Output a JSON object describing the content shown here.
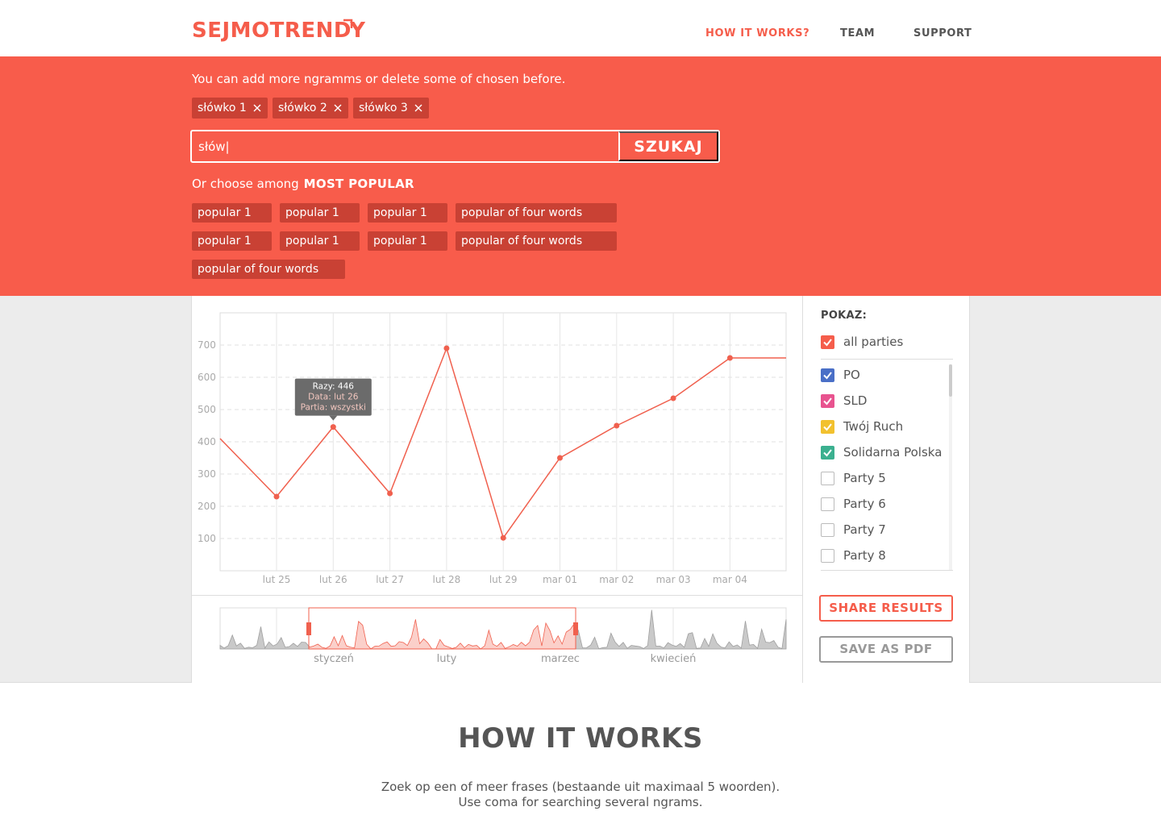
{
  "brand": {
    "name": "SEJMOTRENDY",
    "accent": "#f55d4b",
    "band_color": "#f85c4b",
    "tag_color": "#c94134"
  },
  "nav": {
    "how_it_works": "HOW IT WORKS?",
    "team": "TEAM",
    "support": "SUPPORT"
  },
  "search": {
    "intro": "You can add more ngramms or delete some of chosen before.",
    "tags": [
      "słówko 1",
      "słówko 2",
      "słówko 3"
    ],
    "input_value": "słów|",
    "button": "SZUKAJ",
    "choose_prefix": "Or choose among",
    "choose_bold": "MOST POPULAR",
    "popular": [
      "popular 1",
      "popular 1",
      "popular 1",
      "popular of four words",
      "popular 1",
      "popular 1",
      "popular 1",
      "popular of four words",
      "popular of four words"
    ]
  },
  "chart_data": {
    "type": "line",
    "categories": [
      "lut 25",
      "lut 26",
      "lut 27",
      "lut 28",
      "lut 29",
      "mar 01",
      "mar 02",
      "mar 03",
      "mar 04"
    ],
    "series": [
      {
        "color": "#f0604e",
        "points": [
          {
            "x": "lut 24.5",
            "y": 410
          },
          {
            "x": "lut 25",
            "y": 230
          },
          {
            "x": "lut 26",
            "y": 446
          },
          {
            "x": "lut 27",
            "y": 240
          },
          {
            "x": "lut 28",
            "y": 690
          },
          {
            "x": "lut 29",
            "y": 102
          },
          {
            "x": "mar 01",
            "y": 350
          },
          {
            "x": "mar 02",
            "y": 450
          },
          {
            "x": "mar 03",
            "y": 535
          },
          {
            "x": "mar 04",
            "y": 660
          },
          {
            "x": "mar 05",
            "y": 660
          }
        ]
      }
    ],
    "yticks": [
      100,
      200,
      300,
      400,
      500,
      600,
      700
    ],
    "ylim": [
      0,
      800
    ],
    "grid": true,
    "tooltip": {
      "line1": "Razy: 446",
      "line2": "Data: lut 26",
      "line3": "Partia: wszystki"
    }
  },
  "overview": {
    "labels": [
      "styczeń",
      "luty",
      "marzec",
      "kwiecień"
    ]
  },
  "sidebar": {
    "title": "POKAZ:",
    "all": {
      "label": "all parties",
      "checked": true,
      "color": "#f55d4b"
    },
    "parties": [
      {
        "label": "PO",
        "checked": true,
        "color": "#4a6fc7"
      },
      {
        "label": "SLD",
        "checked": true,
        "color": "#e8538f"
      },
      {
        "label": "Twój Ruch",
        "checked": true,
        "color": "#f2c12e"
      },
      {
        "label": "Solidarna Polska",
        "checked": true,
        "color": "#3bb08f"
      },
      {
        "label": "Party 5",
        "checked": false,
        "color": ""
      },
      {
        "label": "Party 6",
        "checked": false,
        "color": ""
      },
      {
        "label": "Party 7",
        "checked": false,
        "color": ""
      },
      {
        "label": "Party 8",
        "checked": false,
        "color": ""
      }
    ],
    "share": "SHARE RESULTS",
    "pdf": "SAVE AS PDF"
  },
  "how": {
    "title": "HOW IT WORKS",
    "line1": "Zoek op een of meer frases (bestaande uit maximaal 5 woorden).",
    "line2": "Use coma for searching several ngrams."
  }
}
